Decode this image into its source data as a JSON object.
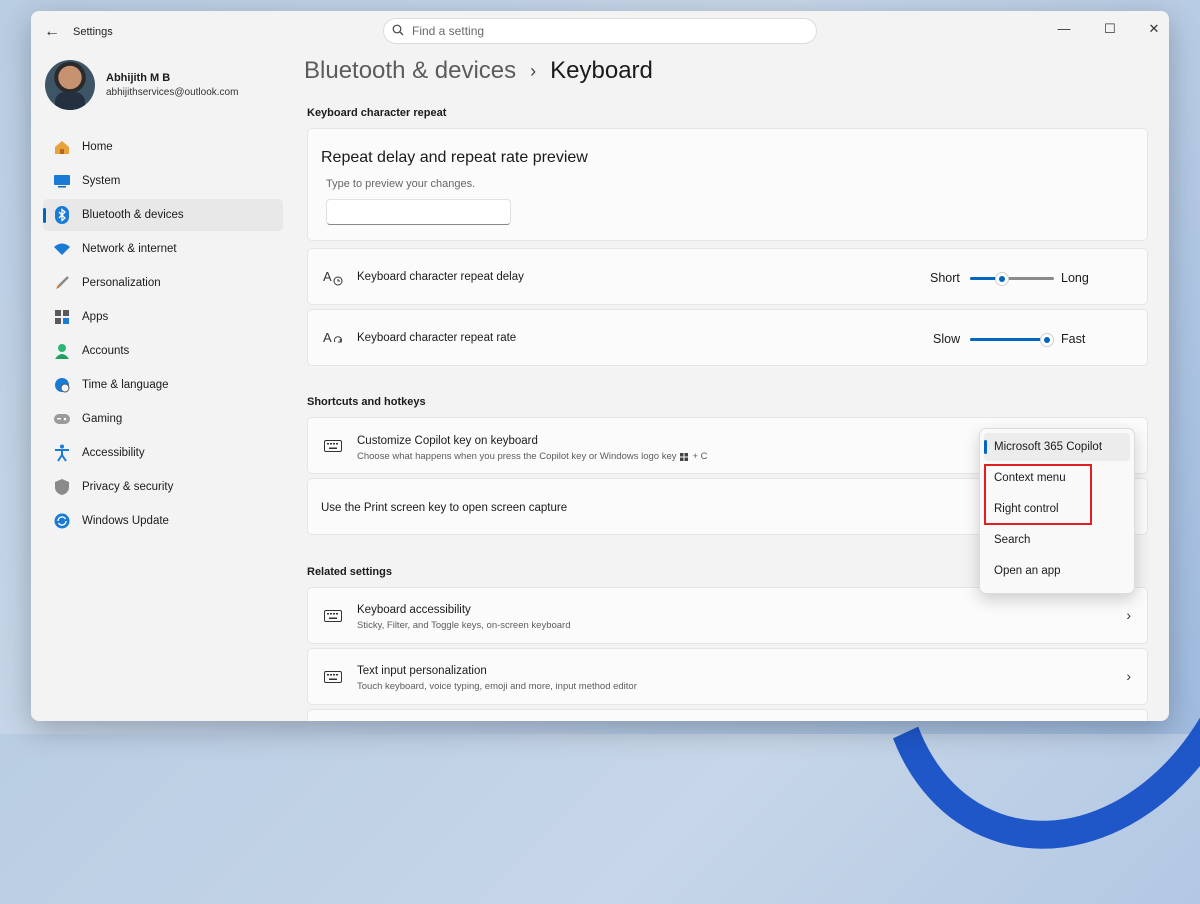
{
  "window": {
    "title": "Settings"
  },
  "search": {
    "placeholder": "Find a setting"
  },
  "profile": {
    "name": "Abhijith M B",
    "email": "abhijithservices@outlook.com"
  },
  "sidebar": {
    "items": [
      {
        "label": "Home",
        "icon": "home-icon"
      },
      {
        "label": "System",
        "icon": "system-icon"
      },
      {
        "label": "Bluetooth & devices",
        "icon": "bluetooth-icon",
        "active": true
      },
      {
        "label": "Network & internet",
        "icon": "wifi-icon"
      },
      {
        "label": "Personalization",
        "icon": "brush-icon"
      },
      {
        "label": "Apps",
        "icon": "apps-icon"
      },
      {
        "label": "Accounts",
        "icon": "accounts-icon"
      },
      {
        "label": "Time & language",
        "icon": "globe-clock-icon"
      },
      {
        "label": "Gaming",
        "icon": "gamepad-icon"
      },
      {
        "label": "Accessibility",
        "icon": "accessibility-icon"
      },
      {
        "label": "Privacy & security",
        "icon": "shield-icon"
      },
      {
        "label": "Windows Update",
        "icon": "update-icon"
      }
    ]
  },
  "breadcrumb": {
    "parent": "Bluetooth & devices",
    "separator": "›",
    "current": "Keyboard"
  },
  "sections": {
    "repeat": "Keyboard character repeat",
    "shortcuts": "Shortcuts and hotkeys",
    "related": "Related settings"
  },
  "preview": {
    "title": "Repeat delay and repeat rate preview",
    "hint": "Type to preview your changes.",
    "input_value": ""
  },
  "repeat_delay": {
    "label": "Keyboard character repeat delay",
    "min_label": "Short",
    "max_label": "Long",
    "value": 0.35
  },
  "repeat_rate": {
    "label": "Keyboard character repeat rate",
    "min_label": "Slow",
    "max_label": "Fast",
    "value": 1.0
  },
  "copilot": {
    "label": "Customize Copilot key on keyboard",
    "desc_prefix": "Choose what happens when you press the Copilot key or Windows logo key",
    "desc_suffix": "+ C"
  },
  "print_screen": {
    "label": "Use the Print screen key to open screen capture"
  },
  "dropdown": {
    "options": [
      "Microsoft 365 Copilot",
      "Context menu",
      "Right control",
      "Search",
      "Open an app"
    ],
    "selected": "Microsoft 365 Copilot"
  },
  "related": [
    {
      "label": "Keyboard accessibility",
      "desc": "Sticky, Filter, and Toggle keys, on-screen keyboard"
    },
    {
      "label": "Text input personalization",
      "desc": "Touch keyboard, voice typing, emoji and more, input method editor"
    }
  ],
  "colors": {
    "accent": "#0067c0",
    "highlight": "#e02020",
    "window_bg": "#f3f3f3",
    "card_bg": "#fbfbfb"
  }
}
